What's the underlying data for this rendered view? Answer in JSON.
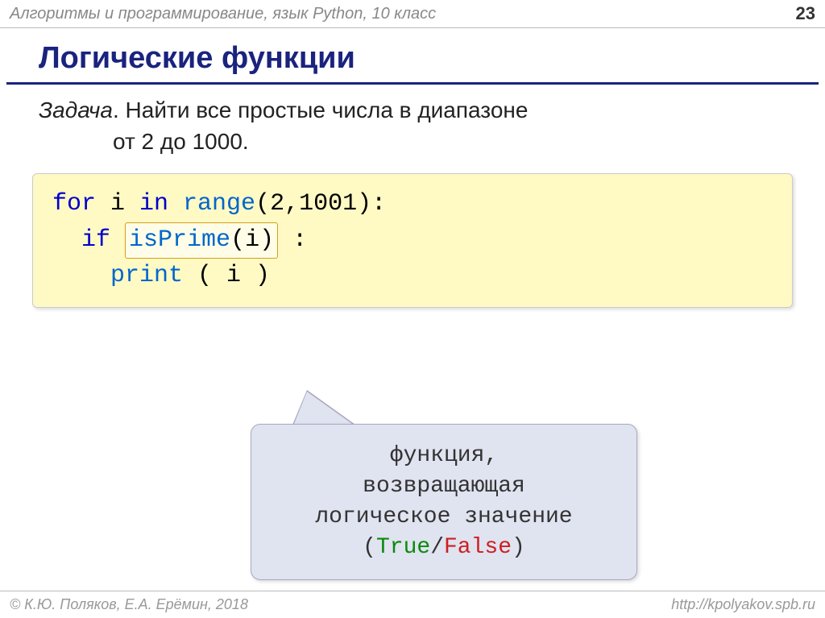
{
  "header": {
    "subject": "Алгоритмы и программирование, язык Python, 10 класс",
    "page_number": "23"
  },
  "title": "Логические функции",
  "task": {
    "label": "Задача",
    "text1": ". Найти все простые числа в диапазоне",
    "text2": "от 2 до 1000."
  },
  "code": {
    "for_kw": "for",
    "i_var1": " i ",
    "in_kw": "in",
    "range_fn": " range",
    "range_args": "(2,1001):",
    "if_kw": "if",
    "isprime_fn": "isPrime",
    "isprime_args": "(i)",
    "colon": " :",
    "print_fn": "print",
    "print_args": " ( i )"
  },
  "callout": {
    "line1": "функция,",
    "line2": "возвращающая",
    "line3": "логическое значение",
    "paren_open": "(",
    "true_val": "True",
    "slash": "/",
    "false_val": "False",
    "paren_close": ")"
  },
  "footer": {
    "copyright": "© К.Ю. Поляков, Е.А. Ерёмин, 2018",
    "url": "http://kpolyakov.spb.ru"
  }
}
